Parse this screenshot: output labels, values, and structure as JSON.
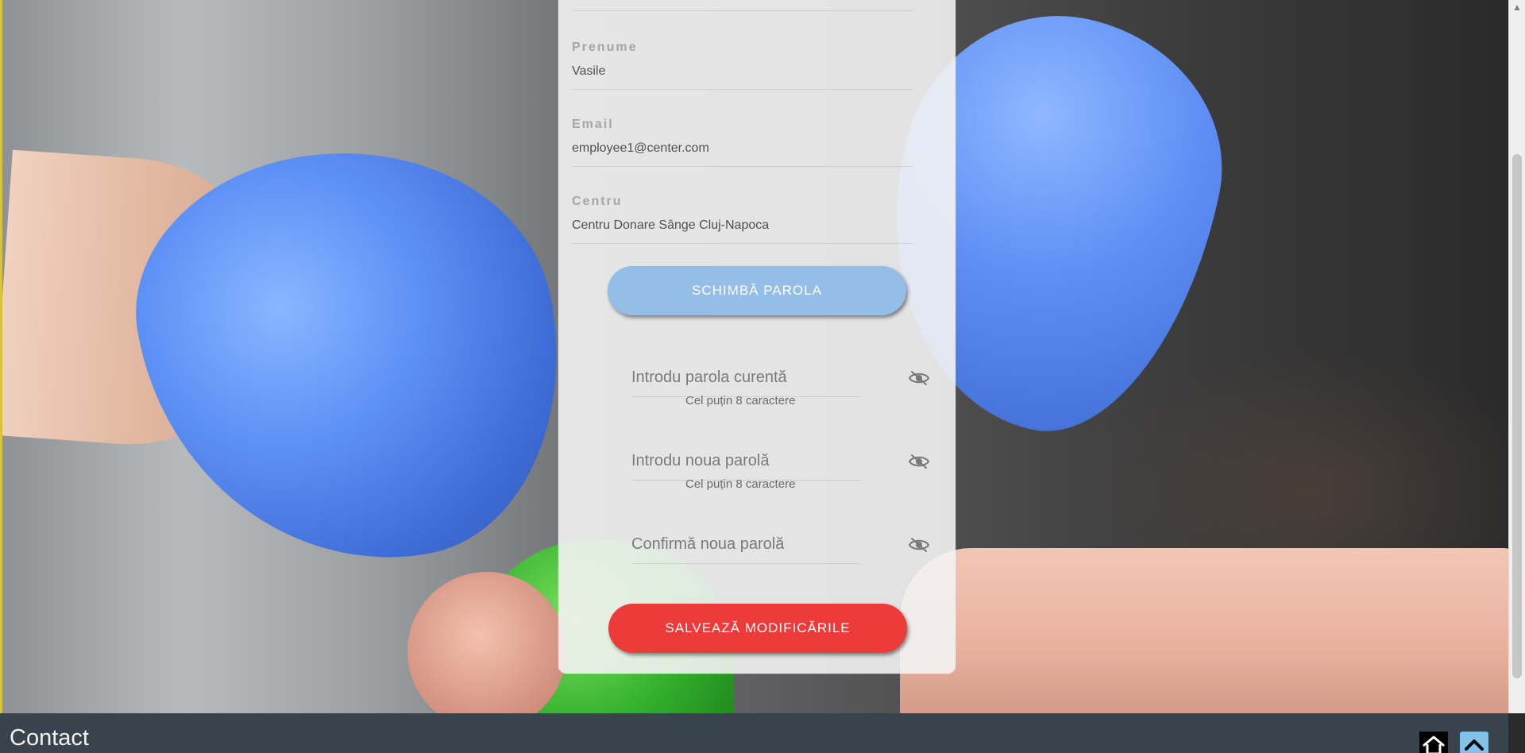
{
  "profile": {
    "prenume": {
      "label": "Prenume",
      "value": "Vasile"
    },
    "email": {
      "label": "Email",
      "value": "employee1@center.com"
    },
    "centru": {
      "label": "Centru",
      "value": "Centru Donare Sânge Cluj-Napoca"
    }
  },
  "password": {
    "change_button_label": "SCHIMBĂ PAROLA",
    "current_placeholder": "Introdu parola curentă",
    "new_placeholder": "Introdu noua parolă",
    "confirm_placeholder": "Confirmă noua parolă",
    "hint": "Cel puțin 8 caractere",
    "visibility_icon": "eye-off-icon"
  },
  "actions": {
    "save_label": "SALVEAZĂ MODIFICĂRILE"
  },
  "footer": {
    "title": "Contact",
    "home_icon": "home-icon",
    "top_icon": "chevron-up-icon"
  },
  "colors": {
    "change_button": "#94bde7",
    "save_button": "#ef3a3a",
    "footer": "#39434e",
    "panel": "#f3f3f3"
  }
}
